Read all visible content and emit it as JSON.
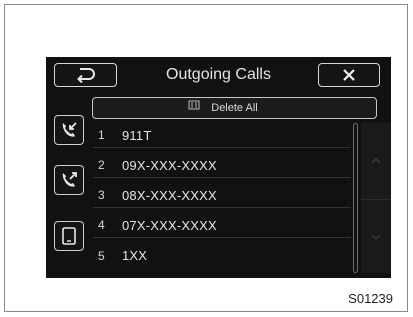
{
  "header": {
    "title": "Outgoing Calls",
    "back_icon": "back-arrow-icon",
    "close_icon": "close-icon"
  },
  "sidebar": {
    "items": [
      {
        "name": "incoming-calls",
        "icon": "incoming-call-icon"
      },
      {
        "name": "outgoing-calls",
        "icon": "outgoing-call-icon"
      },
      {
        "name": "contacts",
        "icon": "phone-device-icon"
      }
    ]
  },
  "toolbar": {
    "delete_all_label": "Delete All"
  },
  "call_list": [
    {
      "index": "1",
      "number": "911T"
    },
    {
      "index": "2",
      "number": "09X-XXX-XXXX"
    },
    {
      "index": "3",
      "number": "08X-XXX-XXXX"
    },
    {
      "index": "4",
      "number": "07X-XXX-XXXX"
    },
    {
      "index": "5",
      "number": "1XX"
    }
  ],
  "scroll": {
    "up_icon": "chevron-up-icon",
    "down_icon": "chevron-down-icon"
  },
  "figure": {
    "code": "S01239"
  },
  "colors": {
    "screen_bg": "#111111",
    "text": "#e6e6e6",
    "border": "#d8d8d8"
  }
}
